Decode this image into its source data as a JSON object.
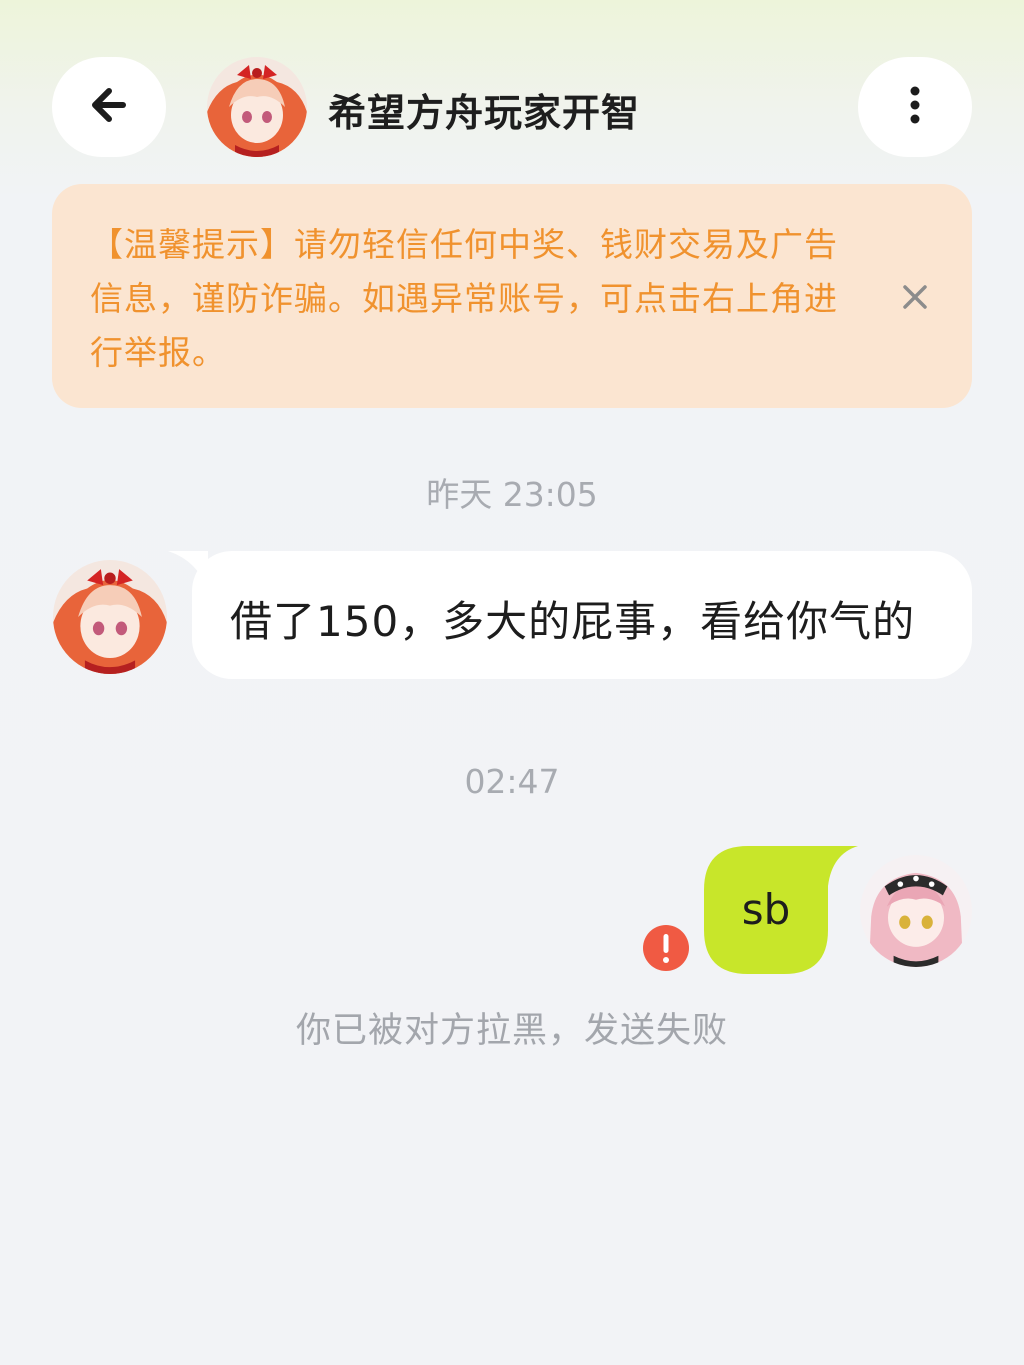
{
  "header": {
    "title": "希望方舟玩家开智",
    "back_icon": "arrow-left-icon",
    "more_icon": "vertical-dots-icon",
    "avatar": "anime-avatar-red-hair"
  },
  "notice": {
    "text": "【温馨提示】请勿轻信任何中奖、钱财交易及广告信息，谨防诈骗。如遇异常账号，可点击右上角进行举报。",
    "close_icon": "close-icon"
  },
  "messages": [
    {
      "timestamp": "昨天 23:05",
      "sender": "peer",
      "text": "借了150，多大的屁事，看给你气的"
    },
    {
      "timestamp": "02:47",
      "sender": "self",
      "text": "sb",
      "status_icon": "error-icon",
      "status_text": "你已被对方拉黑，发送失败"
    }
  ],
  "colors": {
    "notice_bg": "#fbe5d1",
    "notice_text": "#f0922e",
    "self_bubble": "#c8e62a",
    "error_red": "#f05a43"
  }
}
